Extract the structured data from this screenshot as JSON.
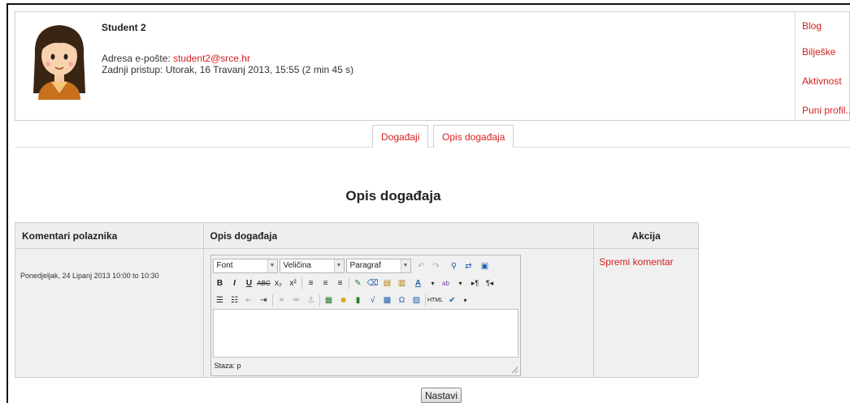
{
  "user": {
    "name": "Student 2",
    "email_label": "Adresa e-pošte: ",
    "email": "student2@srce.hr",
    "last_access": "Zadnji pristup: Utorak, 16 Travanj 2013, 15:55  (2 min 45 s)"
  },
  "sidelinks": [
    "Blog",
    "Bilješke",
    "Aktivnost",
    "Puni profil..."
  ],
  "tabs": [
    "Događaji",
    "Opis događaja"
  ],
  "heading": "Opis događaja",
  "table": {
    "headers": [
      "Komentari polaznika",
      "Opis događaja",
      "Akcija"
    ],
    "row": {
      "date": "Ponedjeljak, 24 Lipanj 2013 10:00 to 10:30",
      "action": "Spremi komentar"
    }
  },
  "editor": {
    "font_select": "Font",
    "size_select": "Veličina",
    "format_select": "Paragraf",
    "path": "Staza: p"
  },
  "submit_label": "Nastavi",
  "colors": {
    "link": "#d32020",
    "header_bg": "#eeeeee",
    "cell_bg": "#f0f0f0"
  }
}
